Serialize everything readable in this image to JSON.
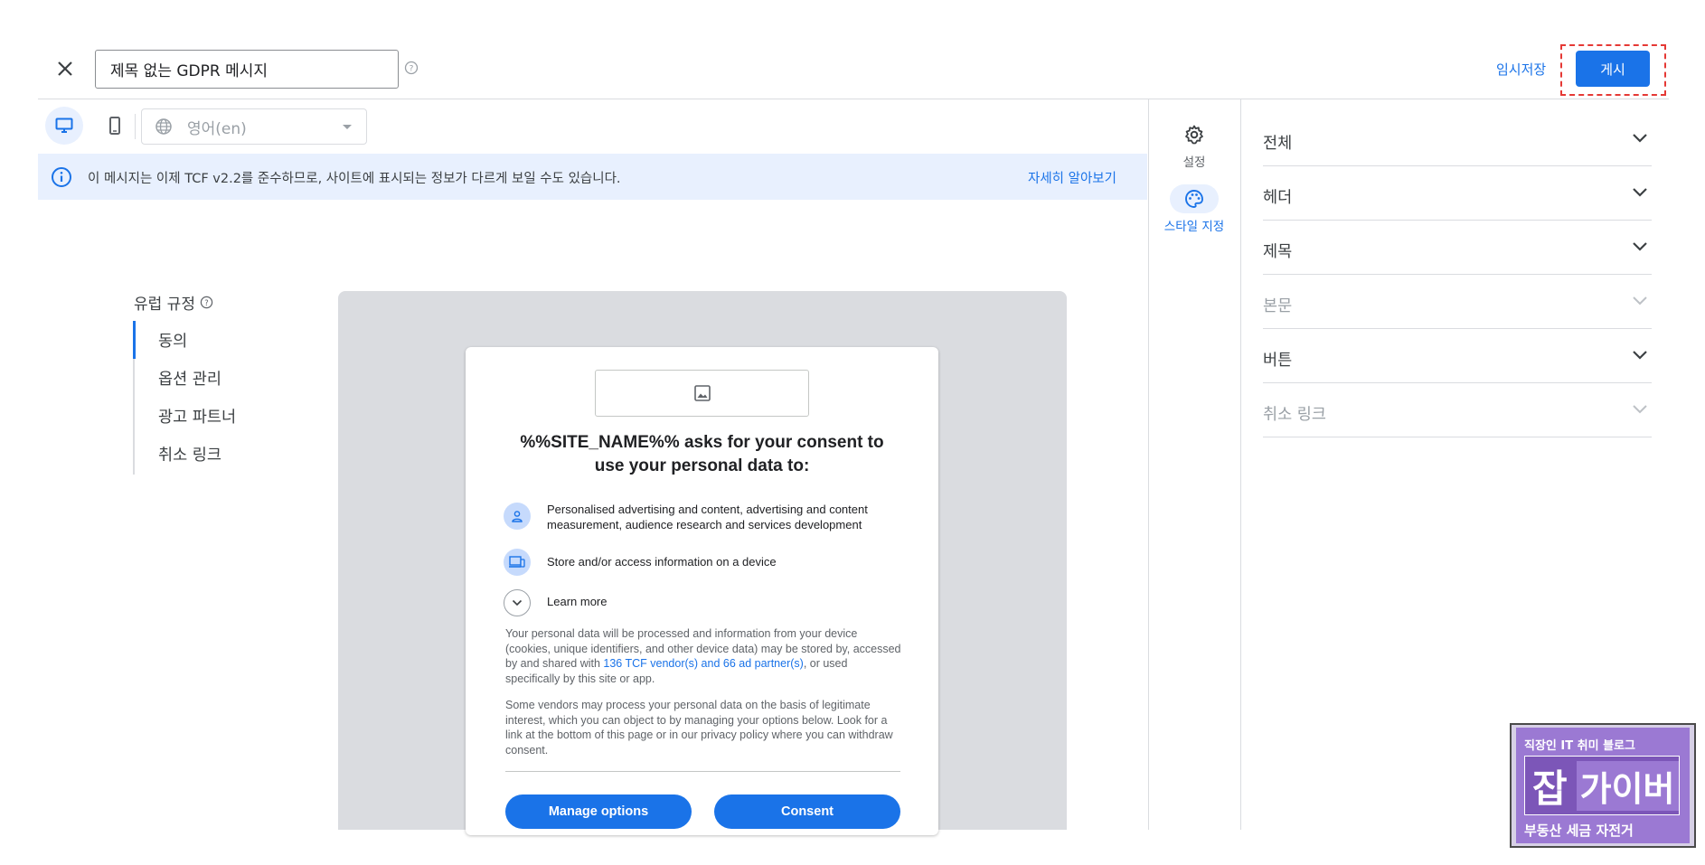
{
  "header": {
    "title_value": "제목 없는 GDPR 메시지",
    "save_draft_label": "임시저장",
    "publish_label": "게시"
  },
  "toolbar": {
    "language_label": "영어(en)"
  },
  "banner": {
    "text": "이 메시지는 이제 TCF v2.2를 준수하므로, 사이트에 표시되는 정보가 다르게 보일 수도 있습니다.",
    "link": "자세히 알아보기"
  },
  "left_nav": {
    "heading": "유럽 규정",
    "items": [
      "동의",
      "옵션 관리",
      "광고 파트너",
      "취소 링크"
    ]
  },
  "consent": {
    "title": "%%SITE_NAME%% asks for your consent to use your personal data to:",
    "purposes": [
      "Personalised advertising and content, advertising and content measurement, audience research and services development",
      "Store and/or access information on a device"
    ],
    "learn_more": "Learn more",
    "para1_a": "Your personal data will be processed and information from your device (cookies, unique identifiers, and other device data) may be stored by, accessed by and shared with ",
    "para1_link": "136 TCF vendor(s) and 66 ad partner(s)",
    "para1_b": ", or used specifically by this site or app.",
    "para2": "Some vendors may process your personal data on the basis of legitimate interest, which you can object to by managing your options below. Look for a link at the bottom of this page or in our privacy policy where you can withdraw consent.",
    "manage_btn": "Manage options",
    "consent_btn": "Consent"
  },
  "rail": {
    "settings_label": "설정",
    "style_label": "스타일 지정"
  },
  "accordion": [
    {
      "label": "전체",
      "enabled": true
    },
    {
      "label": "헤더",
      "enabled": true
    },
    {
      "label": "제목",
      "enabled": true
    },
    {
      "label": "본문",
      "enabled": false
    },
    {
      "label": "버튼",
      "enabled": true
    },
    {
      "label": "취소 링크",
      "enabled": false
    }
  ],
  "watermark": {
    "top": "직장인 IT 취미 블로그",
    "big_a": "잡",
    "big_b": "가이버",
    "bottom": "부동산 세금 자전거"
  },
  "colors": {
    "primary": "#1a73e8",
    "banner_bg": "#e8f0fe",
    "canvas_bg": "#dadce0",
    "highlight_border": "#e53935"
  }
}
